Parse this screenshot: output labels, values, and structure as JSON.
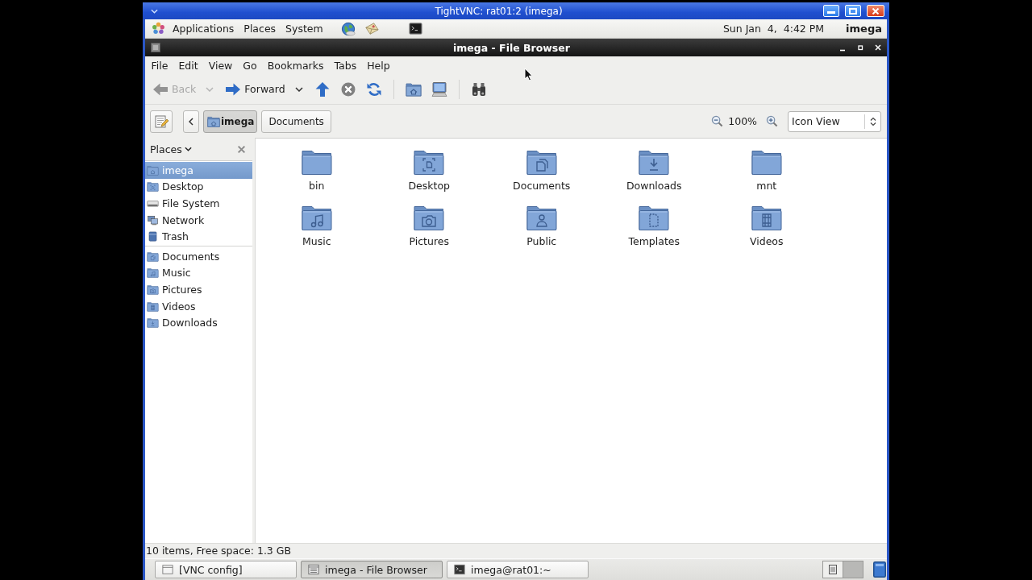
{
  "vnc_window": {
    "title": "TightVNC: rat01:2 (imega)"
  },
  "top_panel": {
    "menus": [
      "Applications",
      "Places",
      "System"
    ],
    "launchers": [
      {
        "kind": "browser"
      },
      {
        "kind": "mail"
      },
      {
        "kind": "terminal"
      }
    ],
    "clock": "Sun Jan  4,  4:42 PM",
    "user": "imega"
  },
  "window": {
    "title": "imega - File Browser"
  },
  "menu_bar": [
    "File",
    "Edit",
    "View",
    "Go",
    "Bookmarks",
    "Tabs",
    "Help"
  ],
  "toolbar": {
    "groups": [
      [
        {
          "kind": "back",
          "label": "Back",
          "disabled": true,
          "dropdown": true
        },
        {
          "kind": "forward",
          "label": "Forward",
          "disabled": false,
          "dropdown": true
        },
        {
          "kind": "up",
          "disabled": false
        },
        {
          "kind": "stop",
          "disabled": true
        },
        {
          "kind": "reload",
          "disabled": false
        }
      ],
      [
        {
          "kind": "home",
          "disabled": false
        },
        {
          "kind": "computer",
          "disabled": false
        }
      ],
      [
        {
          "kind": "search",
          "disabled": false
        }
      ]
    ]
  },
  "location_bar": {
    "path": [
      {
        "label": "imega",
        "kind": "home",
        "selected": true
      },
      {
        "label": "Documents",
        "kind": "folder",
        "selected": false
      }
    ],
    "zoom": "100%",
    "view_mode": "Icon View"
  },
  "places": {
    "title": "Places",
    "sections": [
      [
        {
          "label": "imega",
          "kind": "home",
          "selected": true
        },
        {
          "label": "Desktop",
          "kind": "desktop",
          "selected": false
        },
        {
          "label": "File System",
          "kind": "drive",
          "selected": false
        },
        {
          "label": "Network",
          "kind": "network",
          "selected": false
        },
        {
          "label": "Trash",
          "kind": "trash",
          "selected": false
        }
      ],
      [
        {
          "label": "Documents",
          "kind": "documents",
          "selected": false
        },
        {
          "label": "Music",
          "kind": "music",
          "selected": false
        },
        {
          "label": "Pictures",
          "kind": "pictures",
          "selected": false
        },
        {
          "label": "Videos",
          "kind": "videos",
          "selected": false
        },
        {
          "label": "Downloads",
          "kind": "downloads",
          "selected": false
        }
      ]
    ]
  },
  "files": [
    {
      "name": "bin",
      "kind": "plain",
      "selected": false
    },
    {
      "name": "Desktop",
      "kind": "desktop",
      "selected": false
    },
    {
      "name": "Documents",
      "kind": "documents",
      "selected": false
    },
    {
      "name": "Downloads",
      "kind": "downloads",
      "selected": false
    },
    {
      "name": "mnt",
      "kind": "plain",
      "selected": false
    },
    {
      "name": "Music",
      "kind": "music",
      "selected": false
    },
    {
      "name": "Pictures",
      "kind": "pictures",
      "selected": false
    },
    {
      "name": "Public",
      "kind": "public",
      "selected": false
    },
    {
      "name": "Templates",
      "kind": "templates",
      "selected": false
    },
    {
      "name": "Videos",
      "kind": "videos",
      "selected": false
    }
  ],
  "status_bar": "10 items, Free space: 1.3 GB",
  "taskbar": {
    "tasks": [
      {
        "label": "[VNC config]",
        "kind": "window",
        "selected": false
      },
      {
        "label": "imega - File Browser",
        "kind": "file-browser",
        "selected": true
      },
      {
        "label": "imega@rat01:~",
        "kind": "terminal",
        "selected": false
      }
    ],
    "workspaces": [
      {
        "selected": true
      },
      {
        "selected": false
      }
    ]
  }
}
